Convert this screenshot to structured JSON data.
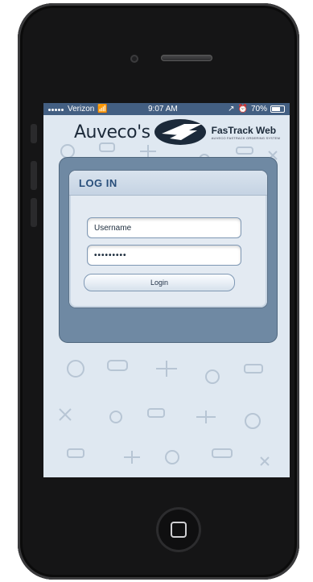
{
  "status_bar": {
    "carrier": "Verizon",
    "time": "9:07 AM",
    "battery": "70%"
  },
  "brand": {
    "company": "Auveco's",
    "product": "FasTrack Web",
    "tagline": "AUVECO FASTRACK ORDERING SYSTEM"
  },
  "login": {
    "title": "LOG IN",
    "username_placeholder": "Username",
    "password_masked": "•••••••••",
    "button_label": "Login"
  },
  "icons": [
    "signal-dots-icon",
    "wifi-icon",
    "location-icon",
    "alarm-icon",
    "battery-icon",
    "fastrack-logo-icon",
    "home-button-icon"
  ],
  "colors": {
    "screen_bg": "#dfe8f1",
    "panel": "#6f89a3",
    "title": "#284e7a",
    "brand_text": "#1c2a3a"
  }
}
